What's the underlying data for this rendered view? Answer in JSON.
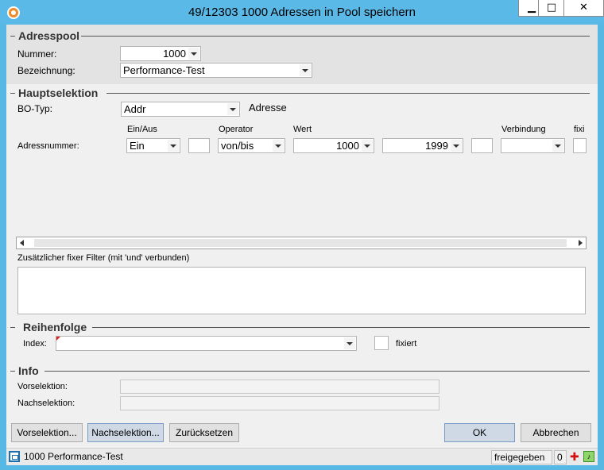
{
  "window": {
    "title": "49/12303 1000 Adressen in Pool speichern",
    "min_glyph": "▁",
    "max_glyph": "□",
    "close_glyph": "✕"
  },
  "adresspool": {
    "title": "Adresspool",
    "nummer_label": "Nummer:",
    "nummer_value": "1000",
    "bezeichnung_label": "Bezeichnung:",
    "bezeichnung_value": "Performance-Test"
  },
  "hauptselektion": {
    "title": "Hauptselektion",
    "botyp_label": "BO-Typ:",
    "botyp_value": "Addr",
    "botyp_desc": "Adresse",
    "columns": {
      "einaus": "Ein/Aus",
      "operator": "Operator",
      "wert": "Wert",
      "verbindung": "Verbindung",
      "fixi": "fixi"
    },
    "row_label": "Adressnummer:",
    "einaus_value": "Ein",
    "operator_value": "von/bis",
    "wert_from": "1000",
    "wert_to": "1999",
    "verbindung_value": "",
    "filter_label": "Zusätzlicher fixer Filter (mit 'und' verbunden)",
    "filter_value": ""
  },
  "reihenfolge": {
    "title": "Reihenfolge",
    "index_label": "Index:",
    "index_value": "",
    "fixiert_label": "fixiert"
  },
  "info": {
    "title": "Info",
    "vorselektion_label": "Vorselektion:",
    "vorselektion_value": "",
    "nachselektion_label": "Nachselektion:",
    "nachselektion_value": ""
  },
  "buttons": {
    "vorselektion": "Vorselektion...",
    "nachselektion": "Nachselektion...",
    "zuruecksetzen": "Zurücksetzen",
    "ok": "OK",
    "abbrechen": "Abbrechen"
  },
  "statusbar": {
    "text": "1000 Performance-Test",
    "state": "freigegeben",
    "count": "0"
  },
  "colors": {
    "titlebar": "#5ab9e6",
    "client": "#f0f0f0",
    "section_bg": "#e3e3e3",
    "active_button": "#cfd9e6"
  }
}
